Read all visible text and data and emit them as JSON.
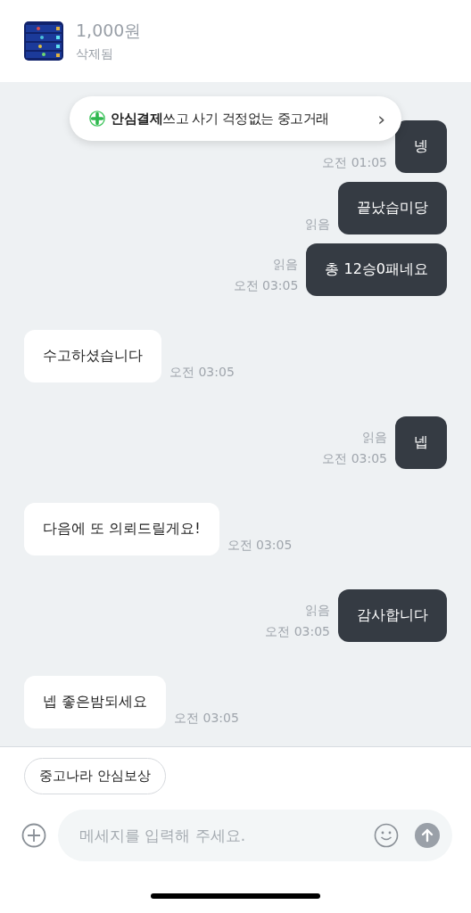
{
  "product": {
    "price": "1,000원",
    "status": "삭제됨"
  },
  "banner": {
    "text": "**안심결제**쓰고 사기 걱정없는 중고거래",
    "chevron": "›"
  },
  "messages": [
    {
      "kind": "sent",
      "text": "넹",
      "time": "오전 01:05"
    },
    {
      "kind": "sent",
      "text": "끝났습미당",
      "read": "읽음"
    },
    {
      "kind": "sent",
      "text": "총 12승0패네요",
      "read": "읽음",
      "time": "오전 03:05"
    },
    {
      "kind": "received",
      "text": "수고하셨습니다",
      "time": "오전 03:05"
    },
    {
      "kind": "sent",
      "text": "넵",
      "read": "읽음",
      "time": "오전 03:05"
    },
    {
      "kind": "received",
      "text": "다음에 또 의뢰드릴게요!",
      "time": "오전 03:05"
    },
    {
      "kind": "sent",
      "text": "감사합니다",
      "read": "읽음",
      "time": "오전 03:05"
    },
    {
      "kind": "received",
      "text": "넵 좋은밤되세요",
      "time": "오전 03:05"
    }
  ],
  "quick_reply": "중고나라 안심보상",
  "composer": {
    "placeholder": "메세지를 입력해 주세요."
  }
}
